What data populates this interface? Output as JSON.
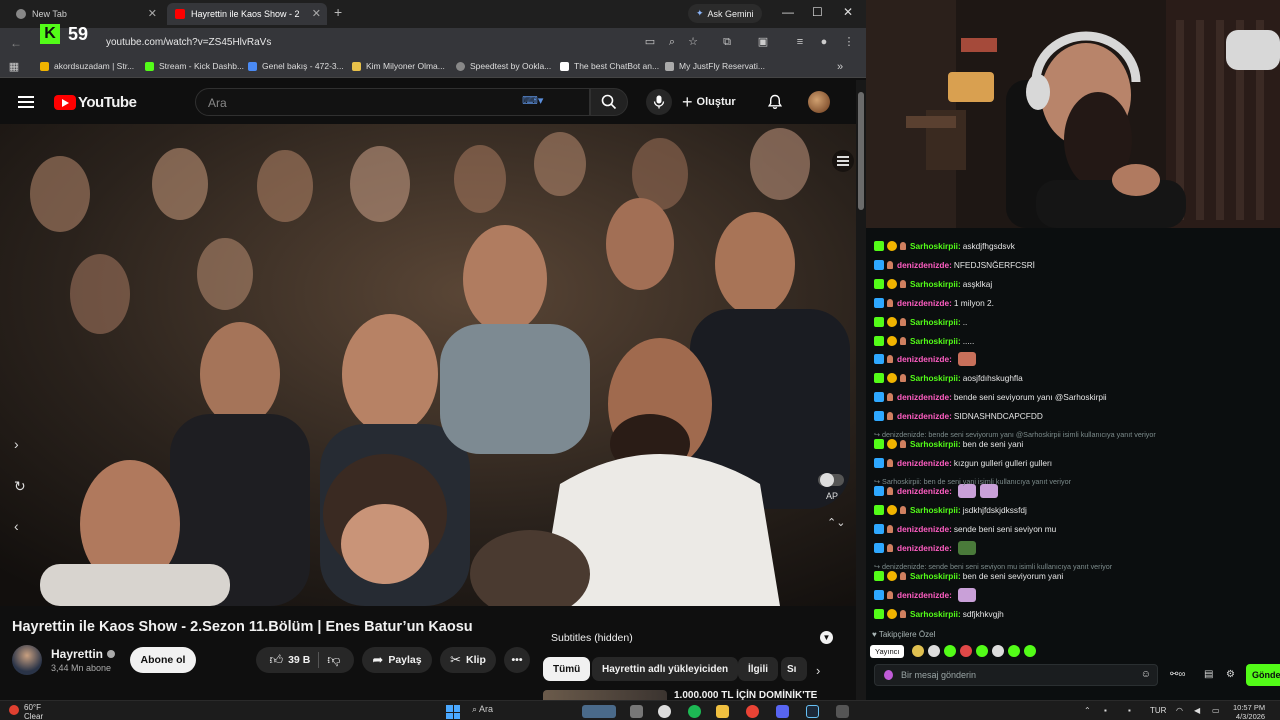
{
  "browser": {
    "tabs": [
      {
        "label": "New Tab",
        "active": false
      },
      {
        "label": "Hayrettin ile Kaos Show - 2",
        "active": true
      }
    ],
    "ask_gemini": "Ask Gemini",
    "url": "youtube.com/watch?v=ZS45HlvRaVs",
    "kick_count": "59",
    "bookmarks": [
      "akordsuzadam | Str...",
      "Stream - Kick Dashb...",
      "Genel bakış - 472-3...",
      "Kim Milyoner Olma...",
      "Speedtest by Ookla...",
      "The best ChatBot an...",
      "My JustFly Reservati..."
    ]
  },
  "youtube": {
    "logo_text": "YouTube",
    "search_placeholder": "Ara",
    "create_label": "Oluştur",
    "autoplay_label": "AP",
    "video_title": "Hayrettin ile Kaos Show - 2.Sezon 11.Bölüm | Enes Batur’un Kaosu",
    "channel_name": "Hayrettin",
    "subscribers": "3,44 Mn abone",
    "subscribe_label": "Abone ol",
    "likes": "39 B",
    "share_label": "Paylaş",
    "clip_label": "Klip",
    "subtitles_label": "Subtitles (hidden)",
    "chips": [
      "Tümü",
      "Hayrettin adlı yükleyiciden",
      "İlgili",
      "Sı"
    ],
    "rec_title": "1.000.000 TL İÇİN DOMİNİK'TE"
  },
  "chat": {
    "messages": [
      {
        "user": "Sarhoskirpii",
        "text": "askdjfhgsdsvk",
        "color": "green"
      },
      {
        "user": "denizdenizde",
        "text": "NFEDJSNĞERFCSRİ",
        "color": "pink"
      },
      {
        "user": "Sarhoskirpii",
        "text": "asşklkaj",
        "color": "green"
      },
      {
        "user": "denizdenizde",
        "text": "1 milyon 2.",
        "color": "pink"
      },
      {
        "user": "Sarhoskirpii",
        "text": "..",
        "color": "green"
      },
      {
        "user": "Sarhoskirpii",
        "text": ".....",
        "color": "green"
      },
      {
        "user": "denizdenizde",
        "text": "",
        "color": "pink"
      },
      {
        "user": "Sarhoskirpii",
        "text": "aosjfdıhskughfla",
        "color": "green"
      },
      {
        "user": "denizdenizde",
        "text": "bende seni seviyorum yanı @Sarhoskirpii",
        "color": "pink"
      },
      {
        "user": "denizdenizde",
        "text": "SIDNASHNDCAPCFDD",
        "color": "pink"
      },
      {
        "user": "Sarhoskirpii",
        "text": "ben de seni yani",
        "color": "green"
      },
      {
        "user": "denizdenizde",
        "text": "kızgun gulleri gulleri gullerı",
        "color": "pink"
      },
      {
        "user": "denizdenizde",
        "text": "",
        "color": "pink"
      },
      {
        "user": "Sarhoskirpii",
        "text": "jsdkhjfdskjdkssfdj",
        "color": "green"
      },
      {
        "user": "denizdenizde",
        "text": "sende beni seni seviyon mu",
        "color": "pink"
      },
      {
        "user": "denizdenizde",
        "text": "",
        "color": "pink"
      },
      {
        "user": "Sarhoskirpii",
        "text": "ben de seni seviyorum yani",
        "color": "green"
      },
      {
        "user": "denizdenizde",
        "text": "",
        "color": "pink"
      },
      {
        "user": "Sarhoskirpii",
        "text": "sdfjkhkvgjh",
        "color": "green"
      }
    ],
    "replies": [
      "denizdenizde: bende seni seviyorum yanı @Sarhoskirpii isimli kullanıcıya yanıt veriyor",
      "Sarhoskirpii: ben de seni yani isimli kullanıcıya yanıt veriyor",
      "denizdenizde: sende beni seni seviyon mu isimli kullanıcıya yanıt veriyor"
    ],
    "followers_only": "Takipçilere Özel",
    "streamer_tag": "Yayıncı",
    "input_placeholder": "Bir mesaj gönderin",
    "send_label": "Gönder"
  },
  "taskbar": {
    "temperature": "60°F",
    "weather": "Clear",
    "search_label": "Ara",
    "language": "TUR",
    "time": "10:57 PM",
    "date": "4/3/2026"
  },
  "colors": {
    "kick_green": "#53fc18",
    "youtube_red": "#ff0000",
    "chat_pink": "#ff5ec3"
  }
}
